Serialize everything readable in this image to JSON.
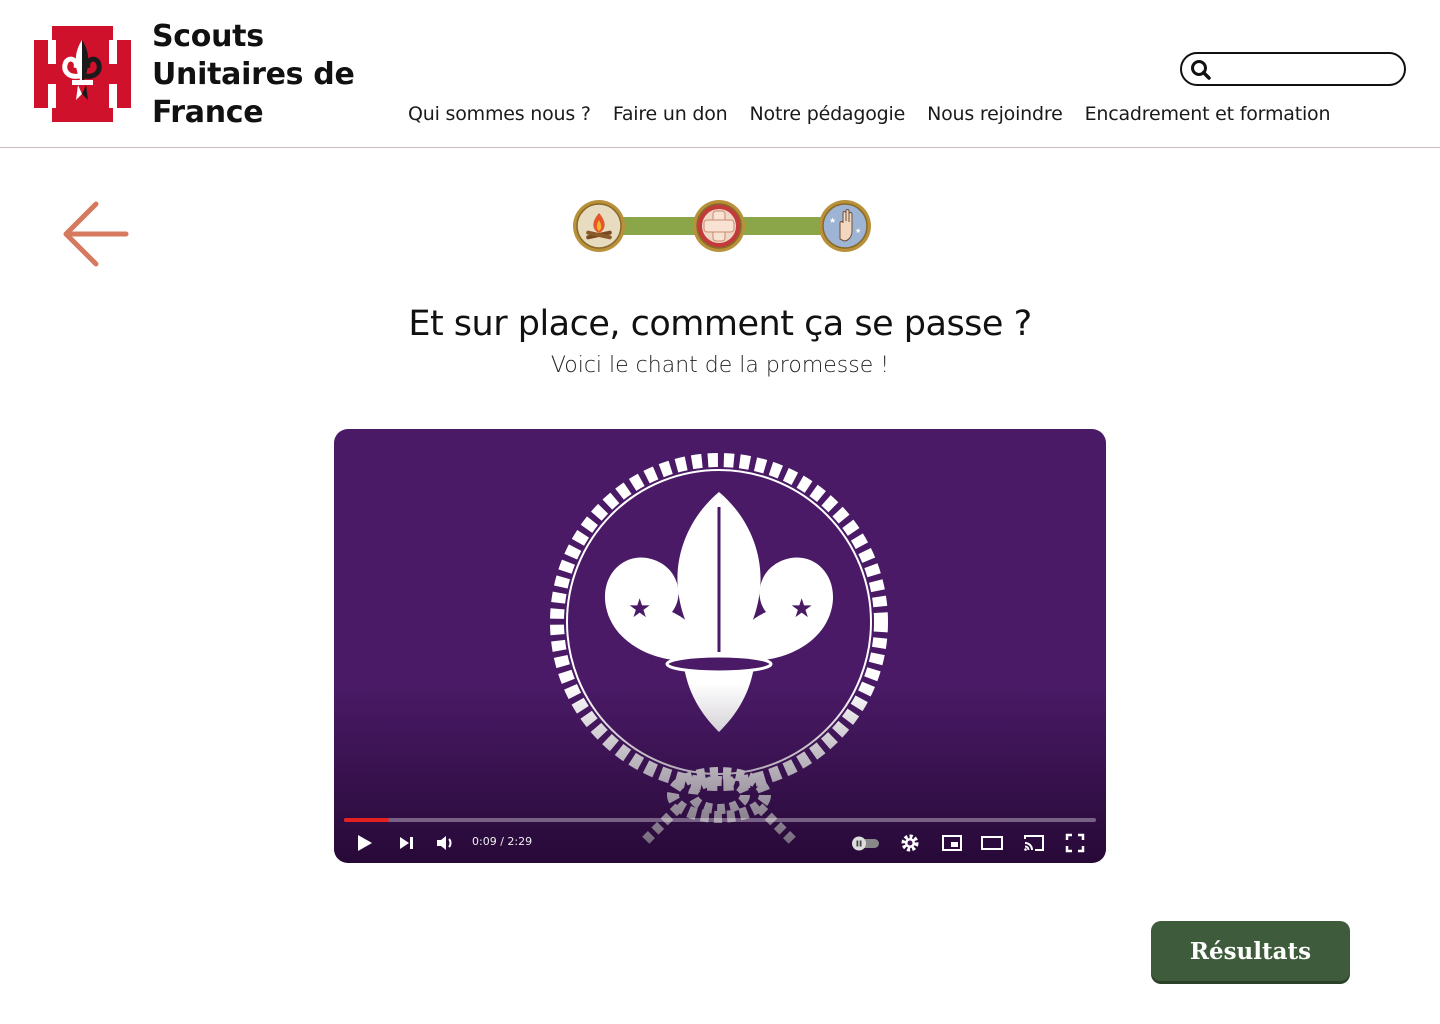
{
  "header": {
    "brand_line1": "Scouts",
    "brand_line2": "Unitaires de",
    "brand_line3": "France",
    "logo_icon": "cross-fleur-de-lis-logo",
    "search": {
      "placeholder": "",
      "icon": "search-icon"
    },
    "nav": [
      {
        "label": "Qui sommes nous ?"
      },
      {
        "label": "Faire un don"
      },
      {
        "label": "Notre pédagogie"
      },
      {
        "label": "Nous rejoindre"
      },
      {
        "label": "Encadrement et formation"
      }
    ]
  },
  "progress": {
    "back_icon": "arrow-left-icon",
    "steps": [
      {
        "icon": "campfire-badge-icon",
        "completed": true
      },
      {
        "icon": "first-aid-badge-icon",
        "completed": true
      },
      {
        "icon": "scout-salute-badge-icon",
        "completed": true
      }
    ]
  },
  "main": {
    "title": "Et sur place, comment ça se passe ?",
    "subtitle": "Voici le chant de la promesse !"
  },
  "video": {
    "emblem_icon": "scout-fleur-de-lis-emblem",
    "time": "0:09 / 2:29",
    "progress_fraction": 0.06,
    "controls": [
      "play-icon",
      "next-icon",
      "volume-icon",
      "autoplay-toggle-icon",
      "settings-icon",
      "miniplayer-icon",
      "theater-icon",
      "cast-icon",
      "fullscreen-icon"
    ]
  },
  "results_button": {
    "label": "Résultats"
  },
  "colors": {
    "logo_red": "#d0112b",
    "progress_green": "#8aa648",
    "back_arrow": "#d57a5e",
    "video_purple": "#4a1a66",
    "results_green": "#3e5c3b"
  }
}
